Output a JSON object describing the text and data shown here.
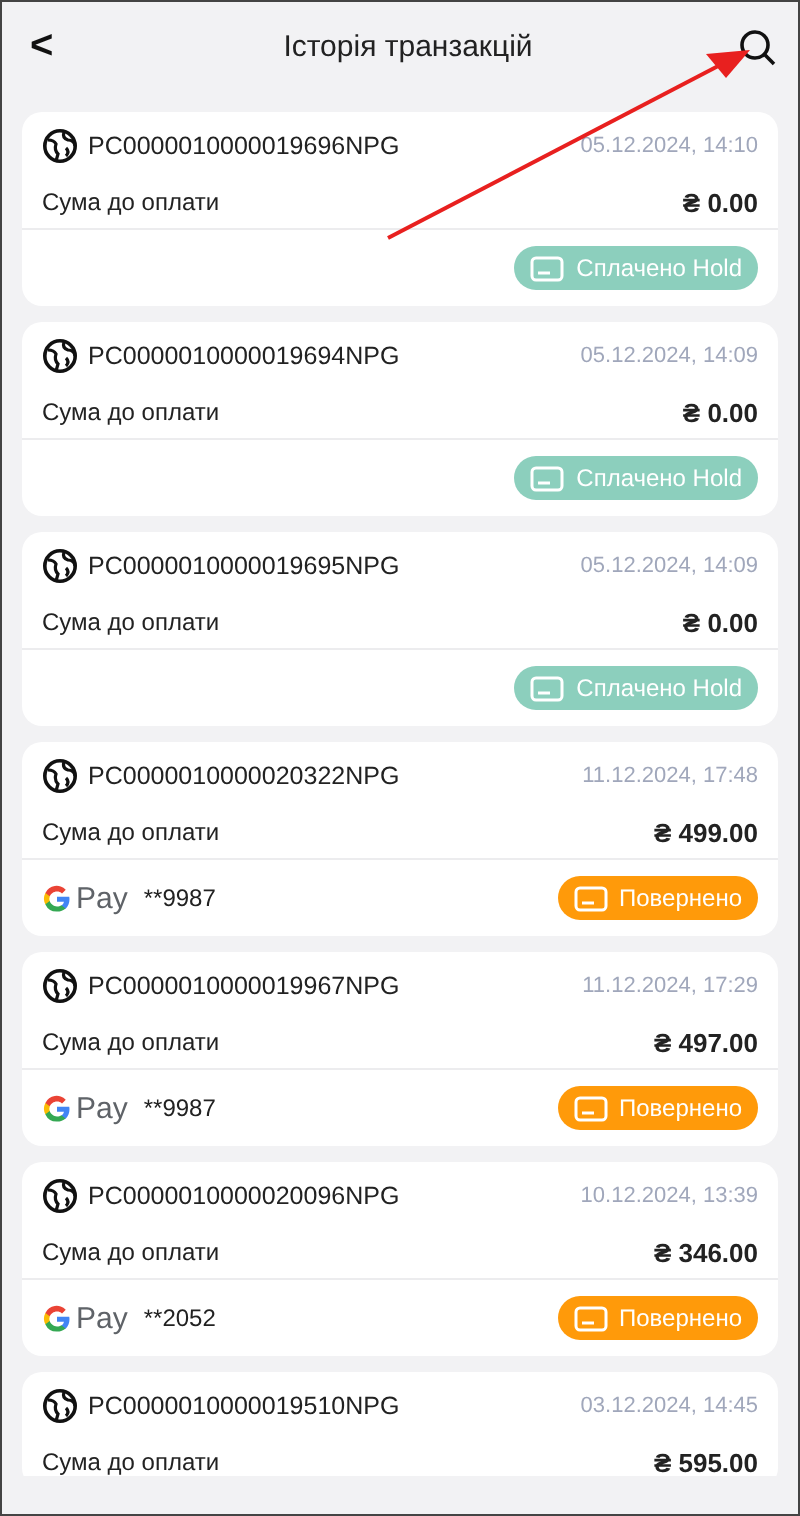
{
  "header": {
    "back": "<",
    "title": "Історія транзакцій"
  },
  "transactions": [
    {
      "id": "PC0000010000019696NPG",
      "date": "05.12.2024, 14:10",
      "amount_label": "Сума до оплати",
      "amount": "₴ 0.00",
      "status": {
        "kind": "hold",
        "label": "Сплачено Hold"
      }
    },
    {
      "id": "PC0000010000019694NPG",
      "date": "05.12.2024, 14:09",
      "amount_label": "Сума до оплати",
      "amount": "₴ 0.00",
      "status": {
        "kind": "hold",
        "label": "Сплачено Hold"
      }
    },
    {
      "id": "PC0000010000019695NPG",
      "date": "05.12.2024, 14:09",
      "amount_label": "Сума до оплати",
      "amount": "₴ 0.00",
      "status": {
        "kind": "hold",
        "label": "Сплачено Hold"
      }
    },
    {
      "id": "PC0000010000020322NPG",
      "date": "11.12.2024, 17:48",
      "amount_label": "Сума до оплати",
      "amount": "₴ 499.00",
      "payment": {
        "kind": "gpay",
        "label": "Pay",
        "card": "**9987"
      },
      "status": {
        "kind": "refunded",
        "label": "Повернено"
      }
    },
    {
      "id": "PC0000010000019967NPG",
      "date": "11.12.2024, 17:29",
      "amount_label": "Сума до оплати",
      "amount": "₴ 497.00",
      "payment": {
        "kind": "gpay",
        "label": "Pay",
        "card": "**9987"
      },
      "status": {
        "kind": "refunded",
        "label": "Повернено"
      }
    },
    {
      "id": "PC0000010000020096NPG",
      "date": "10.12.2024, 13:39",
      "amount_label": "Сума до оплати",
      "amount": "₴ 346.00",
      "payment": {
        "kind": "gpay",
        "label": "Pay",
        "card": "**2052"
      },
      "status": {
        "kind": "refunded",
        "label": "Повернено"
      }
    },
    {
      "id": "PC0000010000019510NPG",
      "date": "03.12.2024, 14:45",
      "amount_label": "Сума до оплати",
      "amount": "₴ 595.00"
    }
  ]
}
